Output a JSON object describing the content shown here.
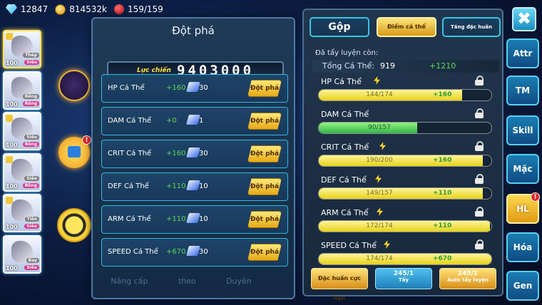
{
  "currencies": [
    {
      "icon": "diamond-icon",
      "value": "12847"
    },
    {
      "icon": "gold-coin-icon",
      "value": "814532k"
    },
    {
      "icon": "apple-icon",
      "value": "159/159"
    }
  ],
  "roster": [
    {
      "level": "100",
      "tags": [
        "Thép",
        "Siêu"
      ]
    },
    {
      "level": "100",
      "tags": [
        "Rồng",
        "Rồng"
      ]
    },
    {
      "level": "100",
      "tags": [
        "Siêu",
        "Rồng"
      ]
    },
    {
      "level": "100",
      "tags": [
        "Siêu",
        "Rồng"
      ]
    },
    {
      "level": "100",
      "tags": [
        "Tiên",
        "Siêu"
      ]
    },
    {
      "level": "100",
      "tags": [
        "Bay",
        "Siêu"
      ]
    }
  ],
  "badges": {
    "bag": "!",
    "hl": "!"
  },
  "breakthrough": {
    "title": "Đột phá",
    "power_label": "Lực chiến",
    "power_value": "9403000",
    "button_label": "Đột phá",
    "rows": [
      {
        "name": "HP Cá Thể",
        "bonus": "+160",
        "cost": "30"
      },
      {
        "name": "DAM Cá Thể",
        "bonus": "+0",
        "cost": "1"
      },
      {
        "name": "CRIT Cá Thể",
        "bonus": "+160",
        "cost": "30"
      },
      {
        "name": "DEF Cá Thể",
        "bonus": "+110",
        "cost": "10"
      },
      {
        "name": "ARM Cá Thể",
        "bonus": "+110",
        "cost": "10"
      },
      {
        "name": "SPEED Cá Thể",
        "bonus": "+670",
        "cost": "30"
      }
    ]
  },
  "bottom_nav": [
    "Nâng cấp",
    "theo",
    "Duyên"
  ],
  "stats": {
    "tabs": [
      "Gộp",
      "Điểm cá thể",
      "Tăng đặc huấn"
    ],
    "remaining_label": "Đã tẩy luyện còn:",
    "total_label": "Tổng Cá Thể:",
    "total_value": "919",
    "total_bonus": "+1210",
    "items": [
      {
        "name": "HP Cá Thể",
        "progress": "144/174",
        "fraction": 0.83,
        "bonus": "+160",
        "boosted": true,
        "color": "yellow"
      },
      {
        "name": "DAM Cá Thể",
        "progress": "90/157",
        "fraction": 0.57,
        "bonus": "",
        "boosted": false,
        "color": "green"
      },
      {
        "name": "CRIT Cá Thể",
        "progress": "190/200",
        "fraction": 0.95,
        "bonus": "+160",
        "boosted": true,
        "color": "yellow"
      },
      {
        "name": "DEF Cá Thể",
        "progress": "149/157",
        "fraction": 0.95,
        "bonus": "+110",
        "boosted": true,
        "color": "yellow"
      },
      {
        "name": "ARM Cá Thể",
        "progress": "172/174",
        "fraction": 0.99,
        "bonus": "+110",
        "boosted": true,
        "color": "yellow"
      },
      {
        "name": "SPEED Cá Thể",
        "progress": "174/174",
        "fraction": 1.0,
        "bonus": "+670",
        "boosted": true,
        "color": "yellow"
      }
    ],
    "actions": [
      {
        "label": "Đặc huấn cực hạn"
      },
      {
        "count": "245/1",
        "label": "Tẩy"
      },
      {
        "count": "245/1",
        "label": "Auto tẩy luyện"
      }
    ]
  },
  "menu": {
    "close_symbol": "✖",
    "items": [
      "Attr",
      "TM",
      "Skill",
      "Mặc",
      "HL",
      "Hóa",
      "Gen"
    ],
    "active": "HL"
  }
}
